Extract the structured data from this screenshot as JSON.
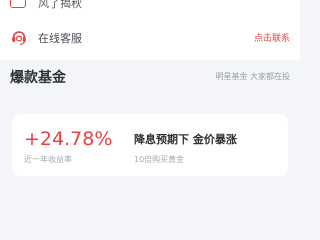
{
  "top_menu": {
    "partial_item": {
      "label": "风了揭秋"
    },
    "chat_item": {
      "label": "在线客服",
      "action_label": "点击联系"
    }
  },
  "section": {
    "title": "爆款基金",
    "subtitle": "明星基金 大家都在投"
  },
  "fund_card": {
    "return_value": "+24.78%",
    "return_label": "近一年收益率",
    "title": "降息预期下 金价暴涨",
    "subtitle": "10倍购买黄金"
  },
  "colors": {
    "accent": "#e8423e",
    "background": "#f3f5f9",
    "card": "#ffffff"
  },
  "icons": {
    "partial_item": "calendar-icon",
    "chat_item": "headset-icon"
  }
}
